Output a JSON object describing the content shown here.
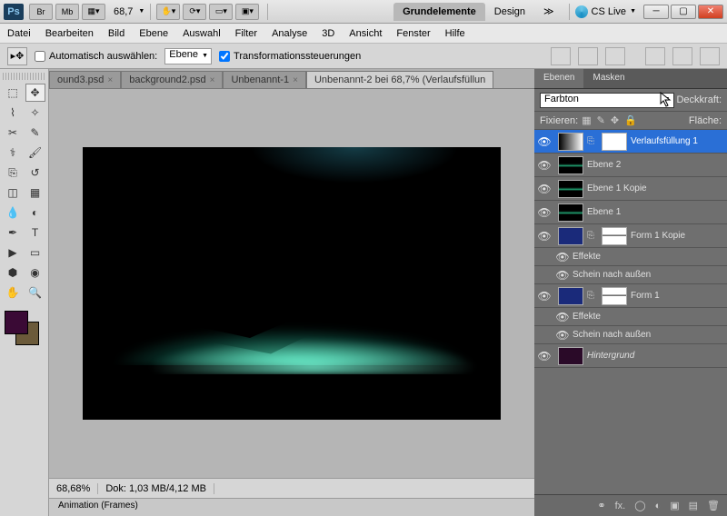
{
  "titlebar": {
    "ps": "Ps",
    "br": "Br",
    "mb": "Mb",
    "zoom": "68,7",
    "workspace_active": "Grundelemente",
    "workspace_2": "Design",
    "cslive": "CS Live"
  },
  "menu": {
    "datei": "Datei",
    "bearbeiten": "Bearbeiten",
    "bild": "Bild",
    "ebene": "Ebene",
    "auswahl": "Auswahl",
    "filter": "Filter",
    "analyse": "Analyse",
    "dreid": "3D",
    "ansicht": "Ansicht",
    "fenster": "Fenster",
    "hilfe": "Hilfe"
  },
  "options": {
    "auto_select": "Automatisch auswählen:",
    "layer_target": "Ebene",
    "transform_controls": "Transformationssteuerungen"
  },
  "doctabs": {
    "t1": "ound3.psd",
    "t2": "background2.psd",
    "t3": "Unbenannt-1",
    "t4": "Unbenannt-2 bei 68,7% (Verlaufsfüllun"
  },
  "status": {
    "zoom": "68,68%",
    "docinfo": "Dok: 1,03 MB/4,12 MB"
  },
  "anim": {
    "tab": "Animation (Frames)"
  },
  "panels": {
    "tab_layers": "Ebenen",
    "tab_masks": "Masken",
    "blend_mode": "Farbton",
    "opacity_label": "Deckkraft:",
    "lock_label": "Fixieren:",
    "fill_label": "Fläche:",
    "layers": {
      "l1": "Verlaufsfüllung 1",
      "l2": "Ebene 2",
      "l3": "Ebene 1 Kopie",
      "l4": "Ebene 1",
      "l5": "Form 1 Kopie",
      "l5e": "Effekte",
      "l5s": "Schein nach außen",
      "l6": "Form 1",
      "l6e": "Effekte",
      "l6s": "Schein nach außen",
      "l7": "Hintergrund"
    }
  }
}
